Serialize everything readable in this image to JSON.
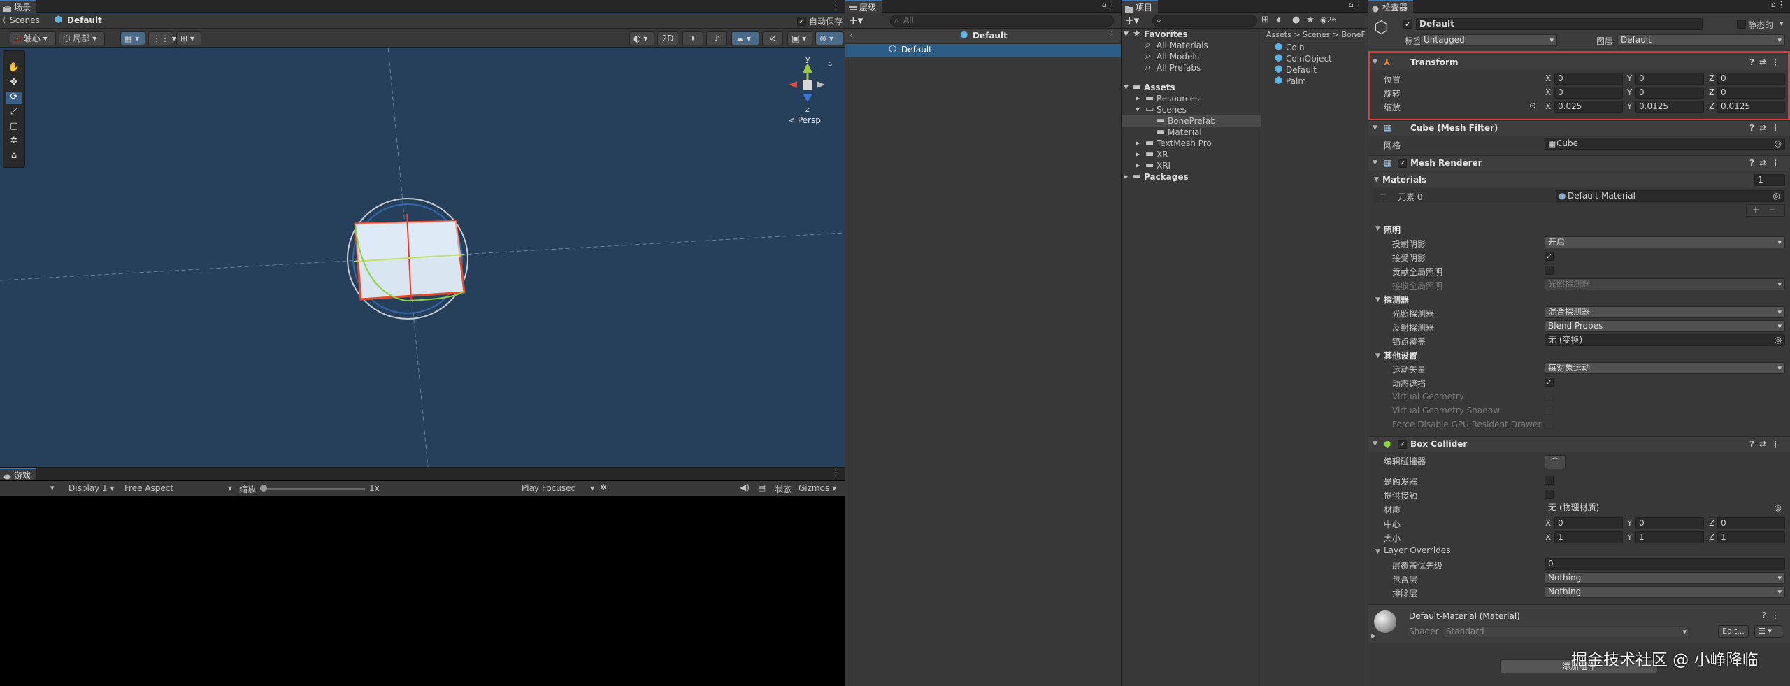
{
  "scene": {
    "tab": "场景",
    "breadcrumb_root": "Scenes",
    "breadcrumb_current": "Default",
    "autosave_label": "自动保存",
    "pivot_label": "轴心",
    "local_label": "局部",
    "mode_2d_label": "2D",
    "persp_label": "< Persp",
    "gizmo_y": "y",
    "gizmo_z": "z"
  },
  "game": {
    "tab": "游戏",
    "display": "Display 1",
    "aspect": "Free Aspect",
    "scale_label": "缩放",
    "scale_value": "1x",
    "play_mode": "Play Focused",
    "status_label": "状态",
    "gizmos_label": "Gizmos"
  },
  "hierarchy": {
    "tab": "层级",
    "search_placeholder": "All",
    "scene_name": "Default",
    "items": [
      "Default"
    ]
  },
  "project": {
    "tab": "项目",
    "count": "26",
    "favorites_title": "Favorites",
    "favorites": [
      "All Materials",
      "All Models",
      "All Prefabs"
    ],
    "assets_title": "Assets",
    "tree": [
      {
        "label": "Resources",
        "indent": 1,
        "arrow": "▶"
      },
      {
        "label": "Scenes",
        "indent": 1,
        "arrow": "▼"
      },
      {
        "label": "BonePrefab",
        "indent": 2,
        "arrow": ""
      },
      {
        "label": "Material",
        "indent": 2,
        "arrow": ""
      },
      {
        "label": "TextMesh Pro",
        "indent": 1,
        "arrow": "▶"
      },
      {
        "label": "XR",
        "indent": 1,
        "arrow": "▶"
      },
      {
        "label": "XRI",
        "indent": 1,
        "arrow": "▶"
      }
    ],
    "packages_title": "Packages",
    "crumbs": [
      "Assets",
      ">",
      "Scenes",
      ">",
      "BoneF"
    ],
    "files": [
      "Coin",
      "CoinObject",
      "Default",
      "Palm"
    ]
  },
  "inspector": {
    "tab": "检查器",
    "object_name": "Default",
    "static_label": "静态的",
    "tag_label": "标签",
    "tag_value": "Untagged",
    "layer_label": "图层",
    "layer_value": "Default",
    "transform": {
      "title": "Transform",
      "position_label": "位置",
      "rotation_label": "旋转",
      "scale_label": "缩放",
      "position": {
        "x": "0",
        "y": "0",
        "z": "0"
      },
      "rotation": {
        "x": "0",
        "y": "0",
        "z": "0"
      },
      "scale": {
        "x": "0.025",
        "y": "0.0125",
        "z": "0.0125"
      }
    },
    "axis": {
      "x": "X",
      "y": "Y",
      "z": "Z"
    },
    "mesh_filter": {
      "title": "Cube (Mesh Filter)",
      "mesh_label": "网格",
      "mesh_value": "Cube"
    },
    "mesh_renderer": {
      "title": "Mesh Renderer",
      "materials_label": "Materials",
      "materials_count": "1",
      "element_label": "元素 0",
      "element_value": "Default-Material",
      "lighting_title": "照明",
      "cast_shadows_label": "投射阴影",
      "cast_shadows_value": "开启",
      "receive_shadows_label": "接受阴影",
      "contribute_gi_label": "贡献全局照明",
      "receive_gi_label": "接收全局照明",
      "receive_gi_value": "光照探测器",
      "probes_title": "探测器",
      "light_probes_label": "光照探测器",
      "light_probes_value": "混合探测器",
      "reflection_probes_label": "反射探测器",
      "reflection_probes_value": "Blend Probes",
      "anchor_label": "锚点覆盖",
      "anchor_value": "无 (变换)",
      "other_title": "其他设置",
      "motion_vectors_label": "运动矢量",
      "motion_vectors_value": "每对象运动",
      "dynamic_occlusion_label": "动态遮挡",
      "virtual_geometry_label": "Virtual Geometry",
      "virtual_geometry_shadow_label": "Virtual Geometry Shadow",
      "force_disable_label": "Force Disable GPU Resident Drawer"
    },
    "box_collider": {
      "title": "Box Collider",
      "edit_label": "编辑碰撞器",
      "is_trigger_label": "是触发器",
      "provides_contacts_label": "提供接触",
      "material_label": "材质",
      "material_value": "无 (物理材质)",
      "center_label": "中心",
      "size_label": "大小",
      "center": {
        "x": "0",
        "y": "0",
        "z": "0"
      },
      "size": {
        "x": "1",
        "y": "1",
        "z": "1"
      },
      "layer_overrides_title": "Layer Overrides",
      "priority_label": "层覆盖优先级",
      "priority_value": "0",
      "include_label": "包含层",
      "include_value": "Nothing",
      "exclude_label": "排除层",
      "exclude_value": "Nothing"
    },
    "material": {
      "title": "Default-Material (Material)",
      "shader_label": "Shader",
      "shader_value": "Standard",
      "edit_label": "Edit..."
    },
    "add_component": "添加组件",
    "watermark": "掘金技术社区 @ 小峥降临"
  },
  "colors": {
    "accent": "#3a79bb",
    "highlight": "#e0393e",
    "scene_bg": "#263f5a",
    "selection": "#2c5d87"
  }
}
